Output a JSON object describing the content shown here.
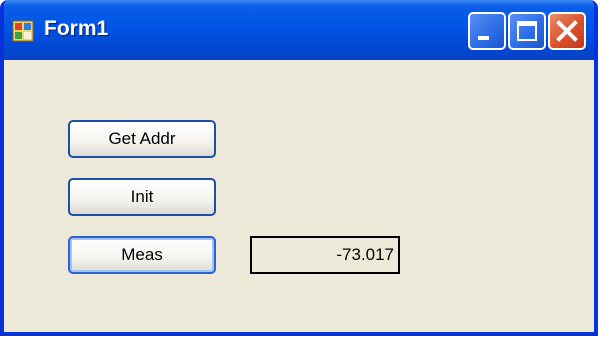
{
  "window": {
    "title": "Form1",
    "icon": "windows-form-icon",
    "controls": {
      "minimize": "minimize-icon",
      "maximize": "maximize-icon",
      "close": "close-icon"
    }
  },
  "buttons": {
    "get_addr": "Get Addr",
    "init": "Init",
    "meas": "Meas"
  },
  "measurement": {
    "value": "-73.017"
  },
  "colors": {
    "titlebar": "#0055e6",
    "client_bg": "#ece9d8",
    "close_button": "#d9512c"
  }
}
